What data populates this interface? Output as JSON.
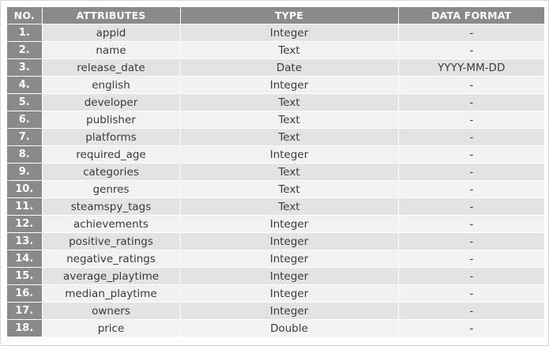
{
  "table": {
    "headers": {
      "no": "NO.",
      "attributes": "ATTRIBUTES",
      "type": "TYPE",
      "data_format": "DATA FORMAT"
    },
    "rows": [
      {
        "no": "1.",
        "attribute": "appid",
        "type": "Integer",
        "format": "-"
      },
      {
        "no": "2.",
        "attribute": "name",
        "type": "Text",
        "format": "-"
      },
      {
        "no": "3.",
        "attribute": "release_date",
        "type": "Date",
        "format": "YYYY-MM-DD"
      },
      {
        "no": "4.",
        "attribute": "english",
        "type": "Integer",
        "format": "-"
      },
      {
        "no": "5.",
        "attribute": "developer",
        "type": "Text",
        "format": "-"
      },
      {
        "no": "6.",
        "attribute": "publisher",
        "type": "Text",
        "format": "-"
      },
      {
        "no": "7.",
        "attribute": "platforms",
        "type": "Text",
        "format": "-"
      },
      {
        "no": "8.",
        "attribute": "required_age",
        "type": "Integer",
        "format": "-"
      },
      {
        "no": "9.",
        "attribute": "categories",
        "type": "Text",
        "format": "-"
      },
      {
        "no": "10.",
        "attribute": "genres",
        "type": "Text",
        "format": "-"
      },
      {
        "no": "11.",
        "attribute": "steamspy_tags",
        "type": "Text",
        "format": "-"
      },
      {
        "no": "12.",
        "attribute": "achievements",
        "type": "Integer",
        "format": "-"
      },
      {
        "no": "13.",
        "attribute": "positive_ratings",
        "type": "Integer",
        "format": "-"
      },
      {
        "no": "14.",
        "attribute": "negative_ratings",
        "type": "Integer",
        "format": "-"
      },
      {
        "no": "15.",
        "attribute": "average_playtime",
        "type": "Integer",
        "format": "-"
      },
      {
        "no": "16.",
        "attribute": "median_playtime",
        "type": "Integer",
        "format": "-"
      },
      {
        "no": "17.",
        "attribute": "owners",
        "type": "Integer",
        "format": "-"
      },
      {
        "no": "18.",
        "attribute": "price",
        "type": "Double",
        "format": "-"
      }
    ]
  },
  "colors": {
    "header_bg": "#8a8a8a",
    "row_odd_bg": "#e3e3e3",
    "row_even_bg": "#f2f2f2",
    "text": "#3a3a3a"
  }
}
